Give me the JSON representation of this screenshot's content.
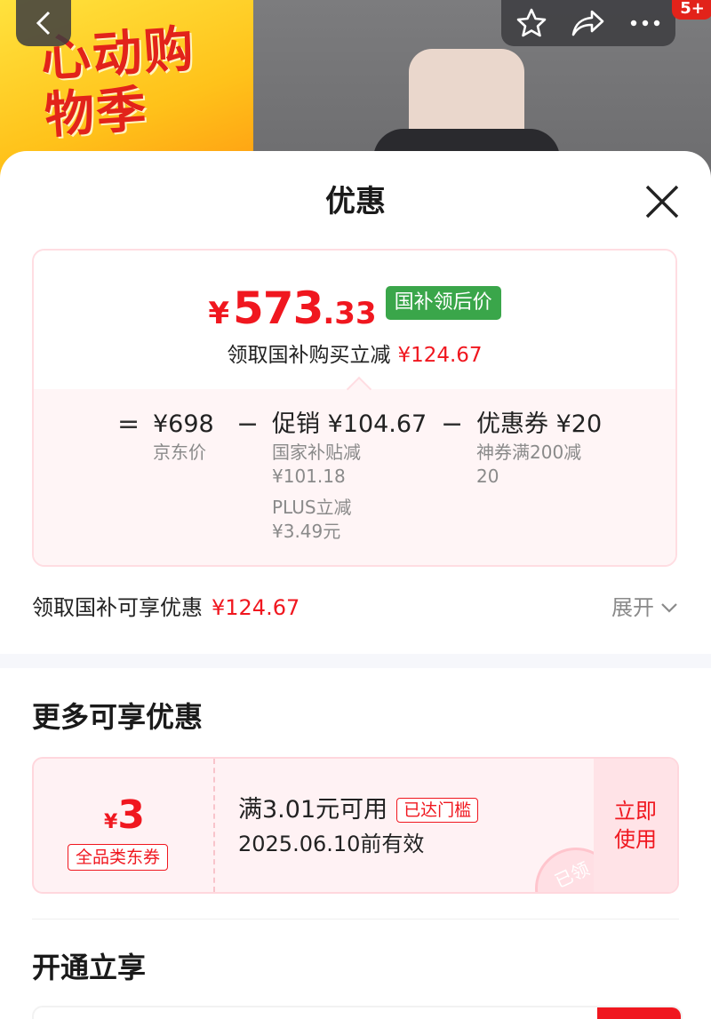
{
  "background": {
    "banner_text": "心动购物季",
    "cart_badge": "5+"
  },
  "sheet": {
    "title": "优惠",
    "price": {
      "currency": "¥",
      "integer": "573",
      "decimal": ".33",
      "tag": "国补领后价",
      "reduce_label": "领取国补购买立减",
      "reduce_amount": "¥124.67"
    },
    "formula": {
      "equals": "=",
      "base_value": "¥698",
      "base_label": "京东价",
      "minus1": "−",
      "promo_value": "促销 ¥104.67",
      "promo_sub1": "国家补贴减",
      "promo_sub1_amount": "¥101.18",
      "promo_sub2": "PLUS立减",
      "promo_sub2_amount": "¥3.49元",
      "minus2": "−",
      "coupon_value": "优惠券 ¥20",
      "coupon_sub1": "神券满200减",
      "coupon_sub2": "20"
    },
    "summary": {
      "label": "领取国补可享优惠",
      "amount": "¥124.67",
      "expand": "展开"
    },
    "more": {
      "title": "更多可享优惠",
      "coupon": {
        "currency": "¥",
        "value": "3",
        "type": "全品类东券",
        "condition": "满3.01元可用",
        "reached": "已达门槛",
        "expiry": "2025.06.10前有效",
        "action": "立即使用",
        "stamp": "已领"
      }
    },
    "open": {
      "title": "开通立享"
    }
  },
  "colors": {
    "accent_red": "#f0171f",
    "tag_green": "#3aa64a"
  }
}
